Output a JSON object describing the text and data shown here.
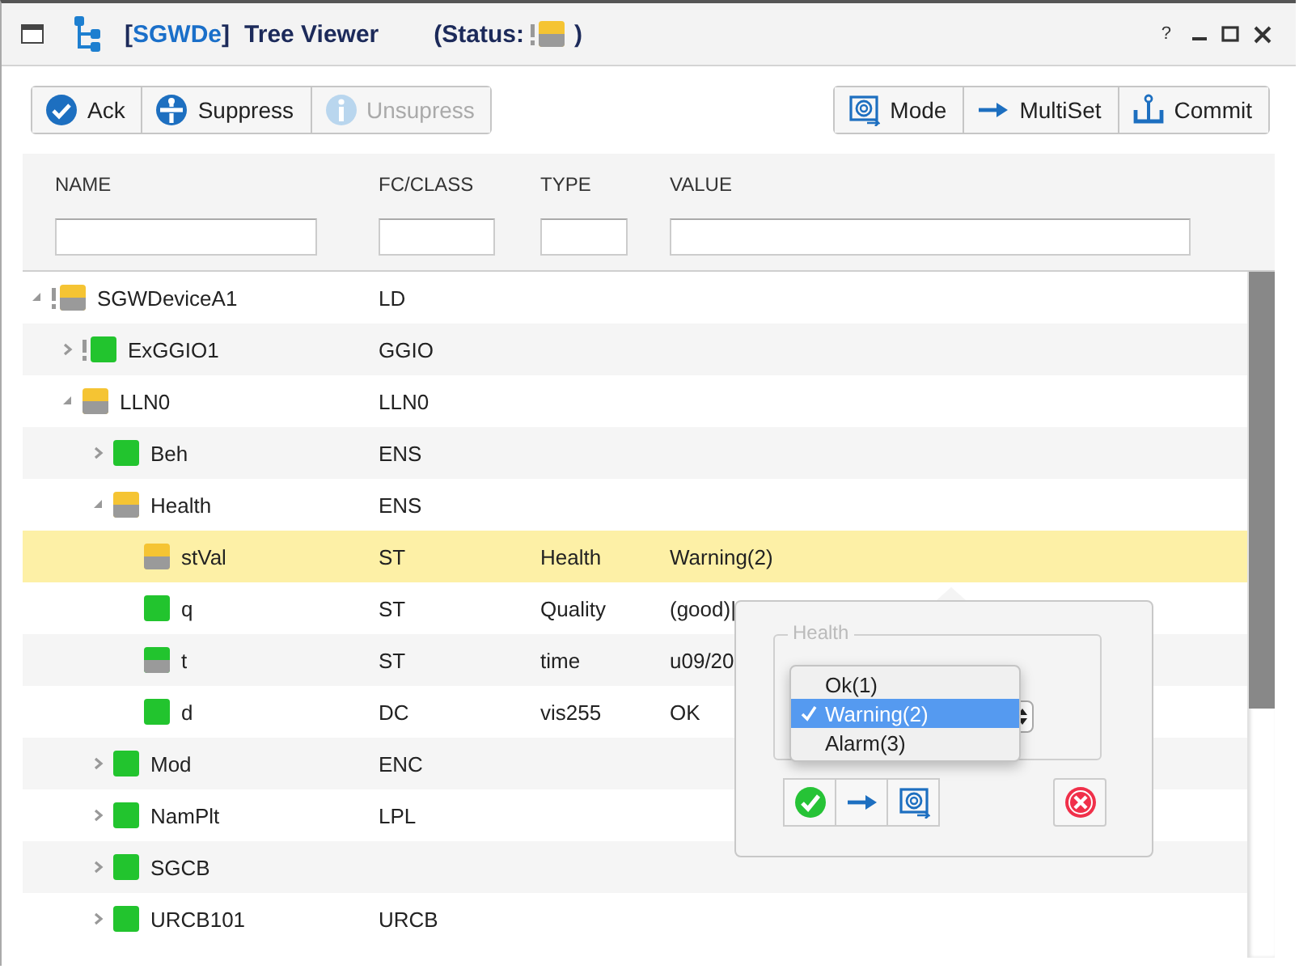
{
  "window": {
    "tag_open": "[",
    "tag": "SGWDe",
    "tag_close": "]",
    "title": "Tree Viewer",
    "status_label": "(Status:",
    "status_close": ")",
    "status": {
      "color": "#f5c433",
      "partial": true,
      "flag": true
    },
    "controls": [
      "?"
    ]
  },
  "toolbar_left": [
    {
      "kind": "ack",
      "label": "Ack",
      "disabled": false
    },
    {
      "kind": "suppress",
      "label": "Suppress",
      "disabled": false
    },
    {
      "kind": "unsuppress",
      "label": "Unsupress",
      "disabled": true
    }
  ],
  "toolbar_right": [
    {
      "kind": "mode",
      "label": "Mode",
      "disabled": false
    },
    {
      "kind": "multiset",
      "label": "MultiSet",
      "disabled": false
    },
    {
      "kind": "commit",
      "label": "Commit",
      "disabled": false
    }
  ],
  "table": {
    "columns": [
      "NAME",
      "FC/CLASS",
      "TYPE",
      "VALUE"
    ],
    "rows": [
      {
        "name": "SGWDeviceA1",
        "fc": "LD",
        "color": "#f5c433",
        "partial": true,
        "flag": true,
        "expanded": true,
        "selected": false,
        "children": [
          {
            "name": "ExGGIO1",
            "fc": "GGIO",
            "color": "#22c42e",
            "partial": false,
            "flag": true,
            "expanded": false,
            "selected": false
          },
          {
            "name": "LLN0",
            "fc": "LLN0",
            "color": "#f5c433",
            "partial": true,
            "flag": false,
            "expanded": true,
            "selected": false,
            "children": [
              {
                "name": "Beh",
                "fc": "ENS",
                "color": "#22c42e",
                "partial": false,
                "flag": false,
                "expanded": false,
                "selected": false
              },
              {
                "name": "Health",
                "fc": "ENS",
                "color": "#f5c433",
                "partial": true,
                "flag": false,
                "expanded": true,
                "selected": false,
                "children": [
                  {
                    "name": "stVal",
                    "fc": "ST",
                    "type": "Health",
                    "value": "Warning(2)",
                    "color": "#f5c433",
                    "partial": true,
                    "flag": false,
                    "selected": true
                  },
                  {
                    "name": "q",
                    "fc": "ST",
                    "type": "Quality",
                    "value": "(good)|",
                    "color": "#22c42e",
                    "partial": false,
                    "flag": false,
                    "selected": false
                  },
                  {
                    "name": "t",
                    "fc": "ST",
                    "type": "time",
                    "value": "u09/20",
                    "color": "#22c42e",
                    "partial": true,
                    "flag": false,
                    "selected": false
                  },
                  {
                    "name": "d",
                    "fc": "DC",
                    "type": "vis255",
                    "value": "OK",
                    "color": "#22c42e",
                    "partial": false,
                    "flag": false,
                    "selected": false
                  }
                ]
              },
              {
                "name": "Mod",
                "fc": "ENC",
                "color": "#22c42e",
                "partial": false,
                "flag": false,
                "expanded": false,
                "selected": false
              },
              {
                "name": "NamPlt",
                "fc": "LPL",
                "color": "#22c42e",
                "partial": false,
                "flag": false,
                "expanded": false,
                "selected": false
              },
              {
                "name": "SGCB",
                "color": "#22c42e",
                "partial": false,
                "flag": false,
                "expanded": false,
                "selected": false
              },
              {
                "name": "URCB101",
                "fc": "URCB",
                "color": "#22c42e",
                "partial": false,
                "flag": false,
                "expanded": false,
                "selected": false
              }
            ]
          }
        ]
      }
    ]
  },
  "editor": {
    "legend": "Health",
    "options": [
      {
        "label": "Ok(1)",
        "selected": false
      },
      {
        "label": "Warning(2)",
        "selected": true
      },
      {
        "label": "Alarm(3)",
        "selected": false
      }
    ],
    "actions": [
      {
        "kind": "apply"
      },
      {
        "kind": "set"
      },
      {
        "kind": "mode"
      },
      {
        "kind": "cancel"
      }
    ]
  }
}
